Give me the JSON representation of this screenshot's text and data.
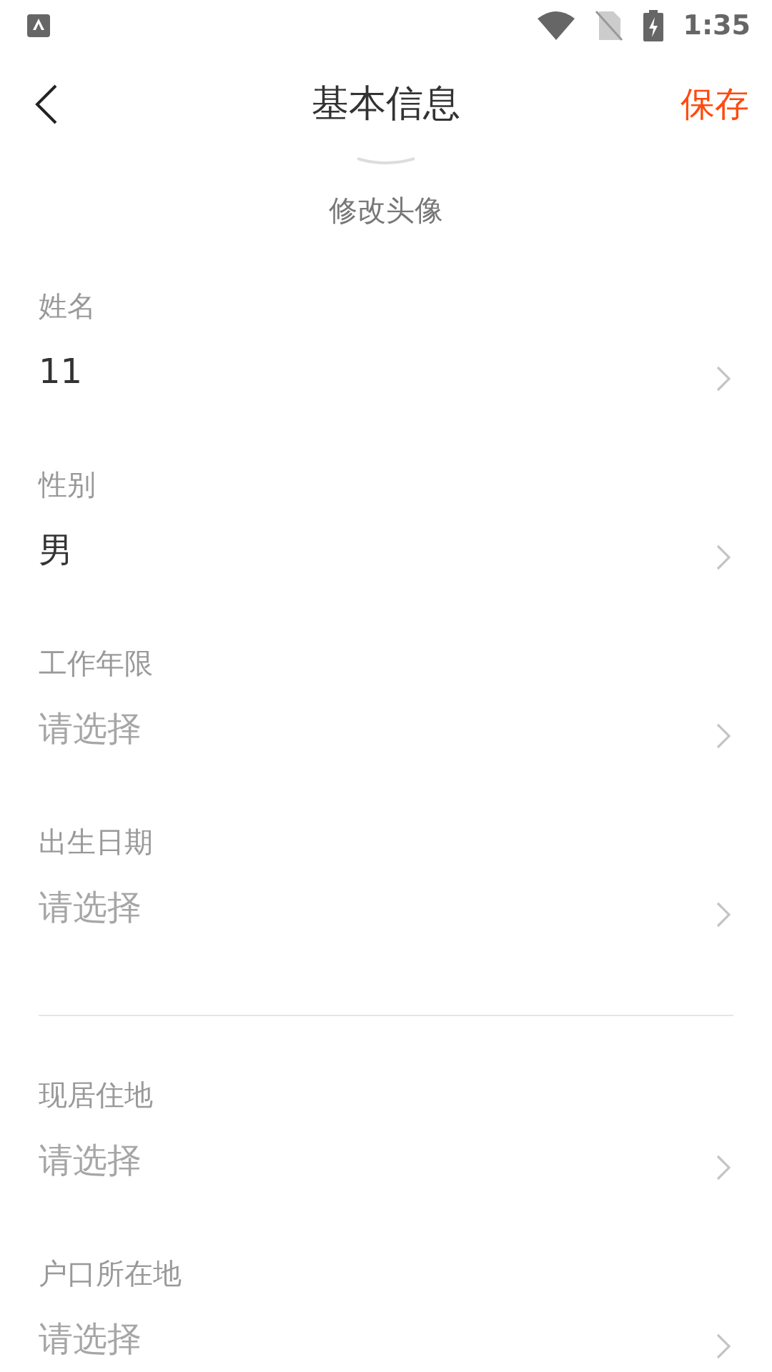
{
  "status_bar": {
    "time": "1:35"
  },
  "header": {
    "title": "基本信息",
    "action": "保存"
  },
  "avatar": {
    "caption": "修改头像"
  },
  "sections": [
    {
      "fields": [
        {
          "label": "姓名",
          "value": "11"
        },
        {
          "label": "性别",
          "value": "男"
        },
        {
          "label": "工作年限",
          "placeholder": "请选择"
        },
        {
          "label": "出生日期",
          "placeholder": "请选择"
        }
      ]
    },
    {
      "fields": [
        {
          "label": "现居住地",
          "placeholder": "请选择"
        },
        {
          "label": "户口所在地",
          "placeholder": "请选择"
        }
      ]
    }
  ]
}
